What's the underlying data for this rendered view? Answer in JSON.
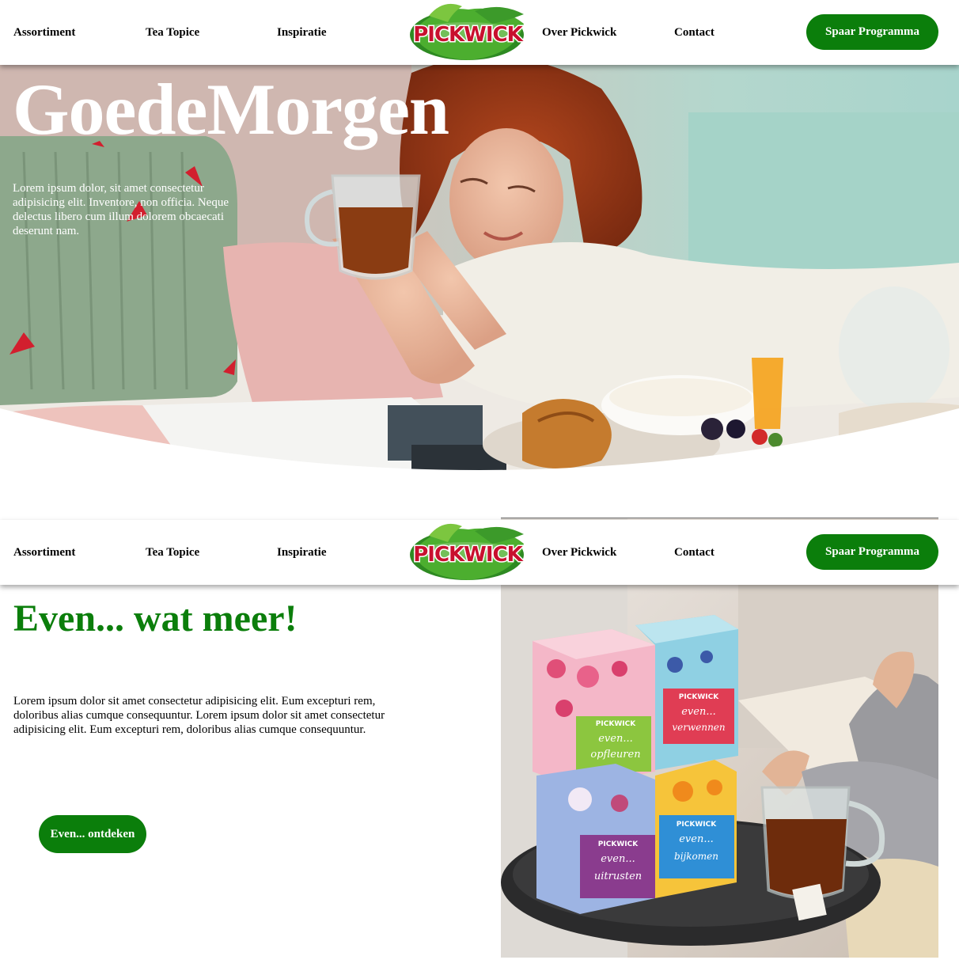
{
  "nav": {
    "items": [
      "Assortiment",
      "Tea Topice",
      "Inspiratie",
      "Over Pickwick",
      "Contact"
    ],
    "logo_text": "PICKWICK",
    "cta_label": "Spaar Programma"
  },
  "hero": {
    "title": "GoedeMorgen",
    "text": "Lorem ipsum dolor, sit amet consectetur adipisicing elit. Inventore, non officia. Neque delectus libero cum illum dolorem obcaecati deserunt nam."
  },
  "section": {
    "title": "Even... wat meer!",
    "text": "Lorem ipsum dolor sit amet consectetur adipisicing elit. Eum excepturi rem, doloribus alias cumque consequuntur. Lorem ipsum dolor sit amet consectetur adipisicing elit. Eum excepturi rem, doloribus alias cumque consequuntur.",
    "button_label": "Even... ontdeken"
  },
  "product": {
    "boxes": [
      {
        "brand": "PICKWICK",
        "line1": "even...",
        "line2": "opfleuren"
      },
      {
        "brand": "PICKWICK",
        "line1": "even...",
        "line2": "verwennen"
      },
      {
        "brand": "PICKWICK",
        "line1": "even...",
        "line2": "uitrusten"
      },
      {
        "brand": "PICKWICK",
        "line1": "even...",
        "line2": "bijkomen"
      }
    ]
  },
  "colors": {
    "brand_green": "#0b7e0b",
    "logo_red": "#c8102e"
  }
}
